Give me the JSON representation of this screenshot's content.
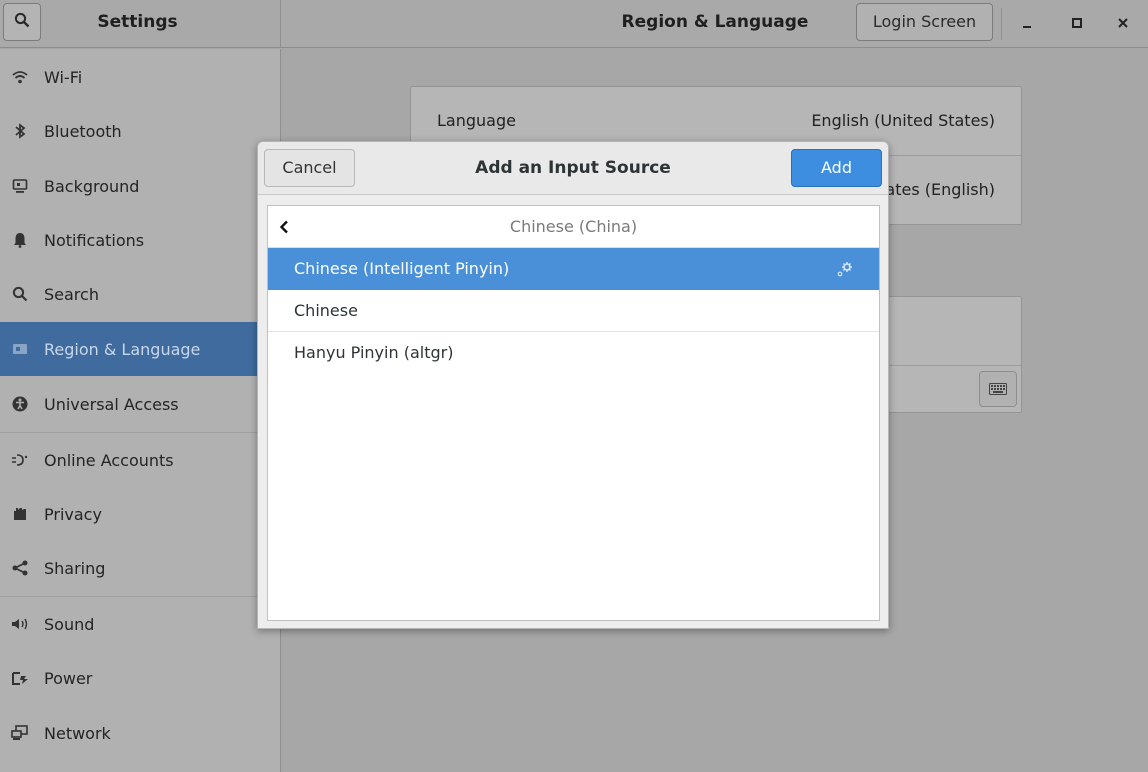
{
  "header": {
    "app_title": "Settings",
    "page_title": "Region & Language",
    "login_screen_label": "Login Screen"
  },
  "sidebar": {
    "items": [
      {
        "label": "Wi-Fi",
        "icon": "wifi-icon"
      },
      {
        "label": "Bluetooth",
        "icon": "bluetooth-icon"
      },
      {
        "label": "Background",
        "icon": "background-icon"
      },
      {
        "label": "Notifications",
        "icon": "bell-icon"
      },
      {
        "label": "Search",
        "icon": "search-icon"
      },
      {
        "label": "Region & Language",
        "icon": "flag-icon",
        "active": true
      },
      {
        "label": "Universal Access",
        "icon": "accessibility-icon"
      },
      {
        "label": "Online Accounts",
        "icon": "online-accounts-icon"
      },
      {
        "label": "Privacy",
        "icon": "hand-icon"
      },
      {
        "label": "Sharing",
        "icon": "share-icon"
      },
      {
        "label": "Sound",
        "icon": "speaker-icon"
      },
      {
        "label": "Power",
        "icon": "power-icon"
      },
      {
        "label": "Network",
        "icon": "network-icon"
      }
    ]
  },
  "main": {
    "language_label": "Language",
    "language_value": "English (United States)",
    "formats_value_partial": "tates (English)"
  },
  "dialog": {
    "cancel_label": "Cancel",
    "title": "Add an Input Source",
    "add_label": "Add",
    "list_header": "Chinese (China)",
    "items": [
      {
        "label": "Chinese (Intelligent Pinyin)",
        "selected": true,
        "has_settings": true
      },
      {
        "label": "Chinese",
        "selected": false
      },
      {
        "label": "Hanyu Pinyin (altgr)",
        "selected": false
      }
    ]
  },
  "colors": {
    "accent": "#4a90d9",
    "sidebar_active": "#3f6b9e",
    "add_button": "#3d8ee0"
  }
}
